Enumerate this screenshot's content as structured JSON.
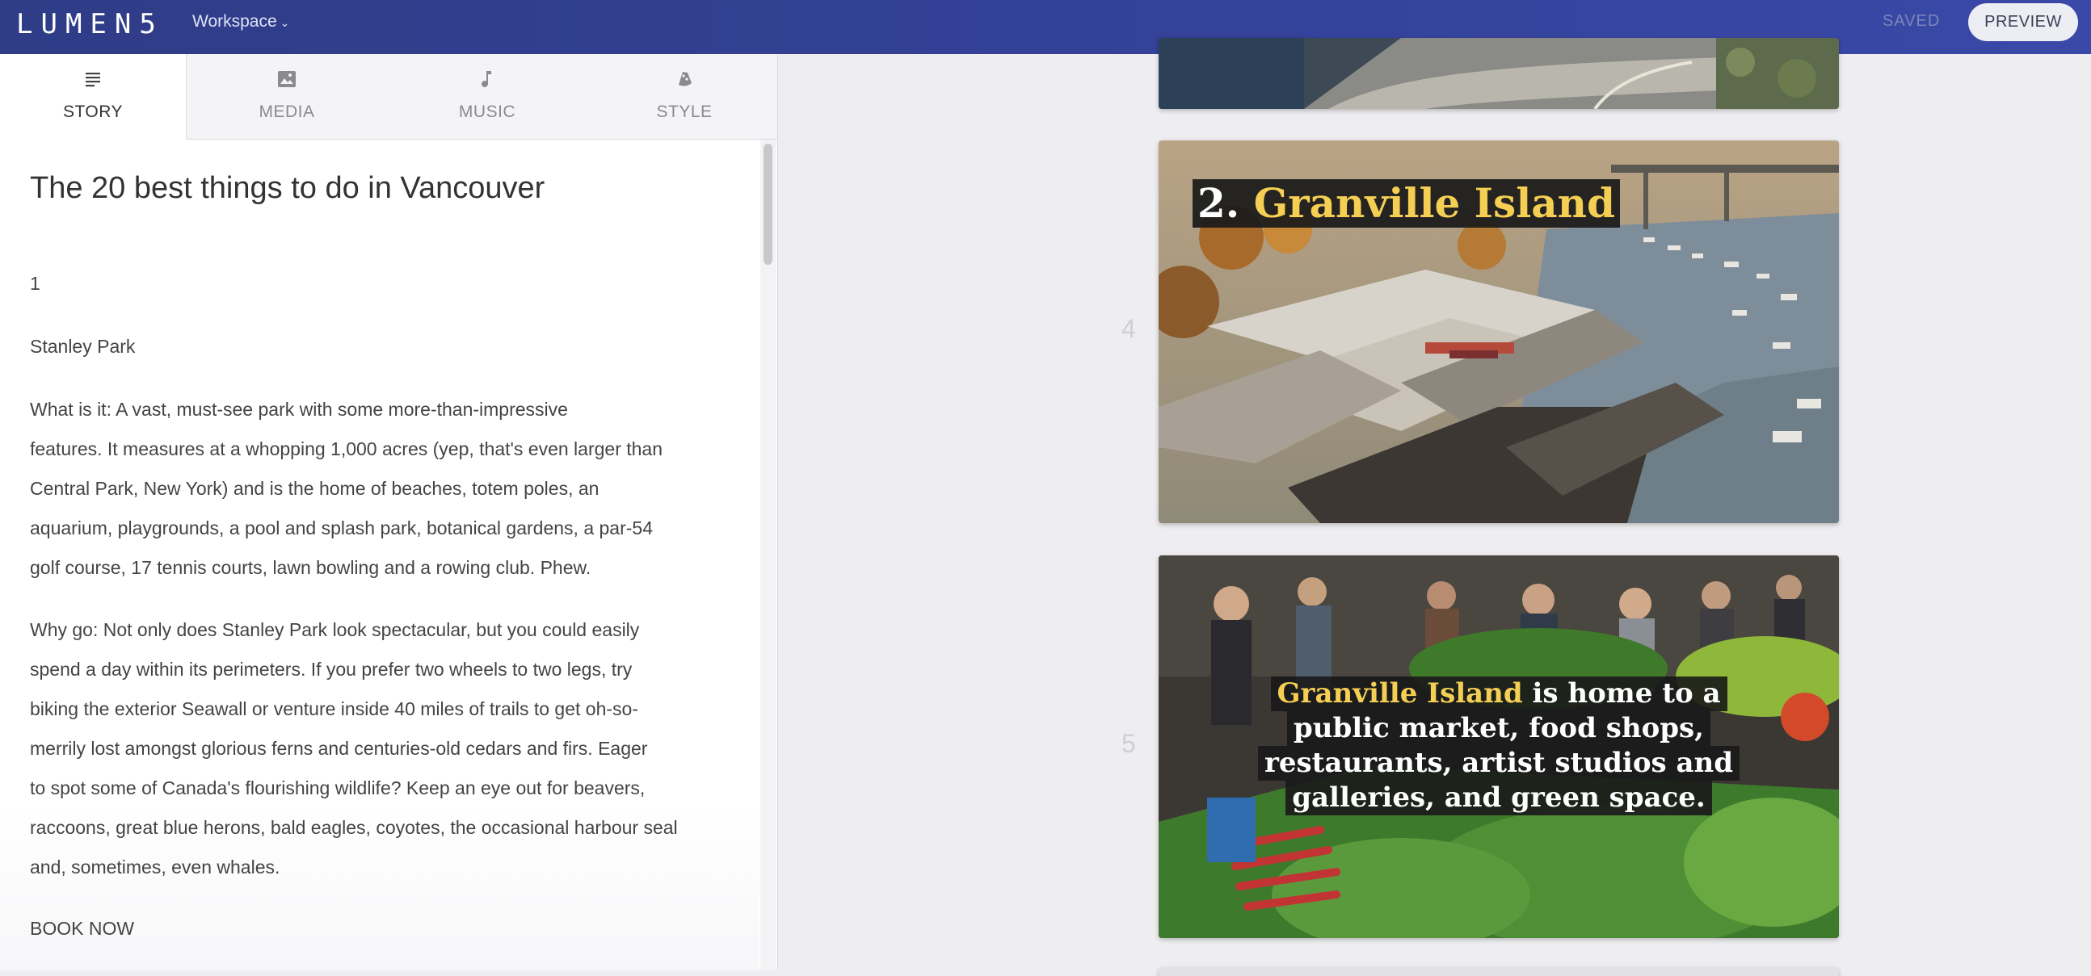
{
  "app": {
    "logo": "LUMEN5",
    "workspace_label": "Workspace",
    "status": "SAVED",
    "preview_label": "PREVIEW"
  },
  "tabs": [
    {
      "label": "STORY",
      "icon": "text-lines-icon",
      "active": true
    },
    {
      "label": "MEDIA",
      "icon": "image-icon",
      "active": false
    },
    {
      "label": "MUSIC",
      "icon": "music-note-icon",
      "active": false
    },
    {
      "label": "STYLE",
      "icon": "palette-icon",
      "active": false
    }
  ],
  "story": {
    "title": "The 20 best things to do in Vancouver",
    "paragraphs": [
      "1",
      "Stanley Park",
      [
        "What is it: A vast, must-see park with some more-than-impressive",
        "features.  It measures at a whopping 1,000 acres (yep, that's even larger than",
        "Central Park, New York) and is the home of beaches, totem poles, an",
        "aquarium, playgrounds, a pool and splash park, botanical gardens, a par-54",
        "golf course, 17 tennis courts, lawn bowling and a rowing club.  Phew."
      ],
      [
        "Why go: Not only does Stanley Park look spectacular, but you could easily",
        "spend a day within its perimeters.  If you prefer two wheels to two legs, try",
        "biking the exterior Seawall or venture inside 40 miles of trails to get oh-so-",
        "merrily lost amongst glorious ferns and centuries-old cedars and firs.  Eager",
        "to spot some of Canada's flourishing wildlife?  Keep an eye out for beavers,",
        "raccoons, great blue herons, bald eagles, coyotes, the occasional harbour seal",
        "and, sometimes, even whales."
      ],
      "BOOK NOW"
    ]
  },
  "slides": [
    {
      "number": "4",
      "title_prefix": "2. ",
      "title_highlight": "Granville Island"
    },
    {
      "number": "5",
      "caption_lines": [
        {
          "highlight": "Granville Island",
          "text": " is home to a"
        },
        {
          "highlight": "",
          "text": "public market, food shops,"
        },
        {
          "highlight": "",
          "text": "restaurants, artist studios and"
        },
        {
          "highlight": "",
          "text": "galleries, and green space."
        }
      ]
    }
  ],
  "colors": {
    "topbar": "#34429a",
    "highlight": "#f5cf54",
    "caption_bg": "#191919"
  }
}
